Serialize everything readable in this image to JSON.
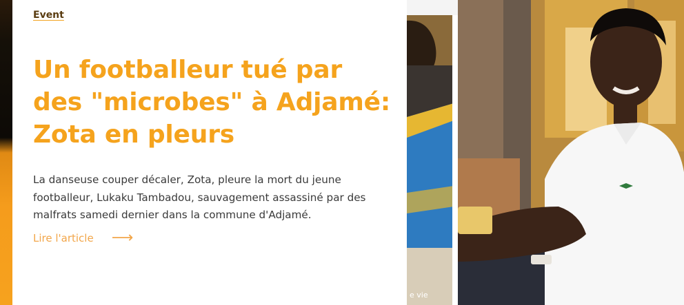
{
  "article": {
    "category": "Event",
    "title": "Un footballeur tué par des \"microbes\" à Adjamé: Zota en pleurs",
    "excerpt": "La danseuse couper décaler, Zota, pleure la mort du jeune footballeur, Lukaku Tambadou, sauvagement assassiné par des malfrats samedi dernier dans la commune d'Adjamé.",
    "read_more_label": "Lire l'article",
    "read_more_icon": "arrow-right-icon",
    "image": {
      "overlay_text": "e vie",
      "description_icon": "article-photo"
    }
  },
  "colors": {
    "accent": "#f5a31d",
    "category_text": "#5a3c10",
    "body_text": "#3a3a3a",
    "sidebar_dark": "#0d0a06",
    "sidebar_orange": "#f59c1c"
  }
}
